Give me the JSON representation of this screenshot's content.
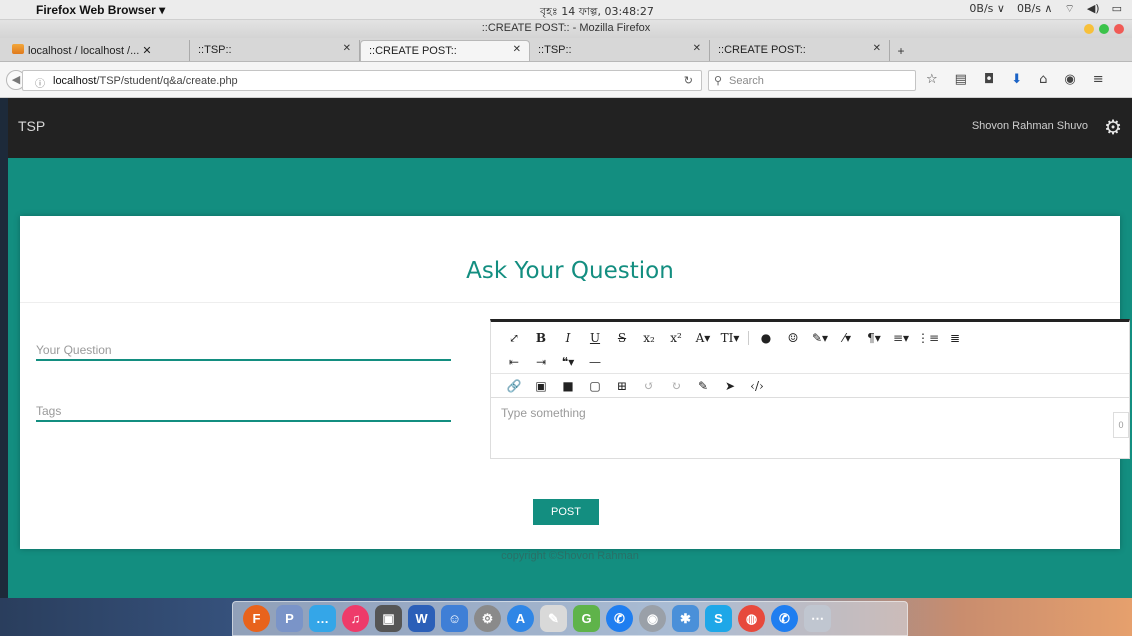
{
  "menubar": {
    "apple_icon": "",
    "app_menu": "Firefox Web Browser ▾",
    "clock": "বৃহঃ 14 ফাল্গ, 03:48:27",
    "status": [
      "0B/s ∨",
      "0B/s ∧",
      "wifi",
      "volume",
      "battery"
    ]
  },
  "window": {
    "title": "::CREATE POST:: - Mozilla Firefox",
    "lights": [
      "#f7c03a",
      "#3bc34a",
      "#f05a55"
    ]
  },
  "tabs": [
    {
      "label": "localhost / localhost /... ✕",
      "active": false
    },
    {
      "label": "::TSP::",
      "active": false
    },
    {
      "label": "::CREATE POST::",
      "active": true
    },
    {
      "label": "::TSP::",
      "active": false
    },
    {
      "label": "::CREATE POST::",
      "active": false
    }
  ],
  "new_tab": "+",
  "navbar": {
    "url_host": "localhost",
    "url_path": "/TSP/student/q&a/create.php",
    "search_placeholder": "Search"
  },
  "site": {
    "brand": "TSP",
    "user_name": "Shovon Rahman Shuvo",
    "heading": "Ask Your Question",
    "question_placeholder": "Your Question",
    "tags_placeholder": "Tags",
    "editor_placeholder": "Type something",
    "char_count": "0",
    "post_label": "POST",
    "footer": "copyright ©Shovon Rahman"
  },
  "editor_toolbar": {
    "row1": [
      "⤢",
      "B",
      "I",
      "U",
      "S",
      "x₂",
      "x²",
      "A▾",
      "TI▾",
      "●",
      "☺",
      "✎▾",
      "⁄▾",
      "¶▾",
      "≡▾",
      "⋮≡",
      "≣"
    ],
    "row2": [
      "⇤",
      "⇥",
      "❝▾",
      "—"
    ],
    "row3": [
      "🔗",
      "▣",
      "■",
      "▢",
      "⊞",
      "↺",
      "↻",
      "✎",
      "➤",
      "‹/›"
    ]
  },
  "colors": {
    "accent": "#138e80",
    "navbar_bg": "#222222"
  },
  "dock": [
    {
      "icon": "firefox-icon",
      "color": "#e8631c"
    },
    {
      "icon": "preview-icon",
      "color": "#7a94c8"
    },
    {
      "icon": "messages-icon",
      "color": "#34a6e8"
    },
    {
      "icon": "itunes-icon",
      "color": "#ee3b6a"
    },
    {
      "icon": "photo-booth-icon",
      "color": "#555555"
    },
    {
      "icon": "word-icon",
      "color": "#2b5fb8"
    },
    {
      "icon": "finder-icon",
      "color": "#3f7fd6"
    },
    {
      "icon": "sys-prefs-icon",
      "color": "#8a8a8a"
    },
    {
      "icon": "app-store-icon",
      "color": "#2f86e6"
    },
    {
      "icon": "instruments-icon",
      "color": "#d9d9d9"
    },
    {
      "icon": "growl-icon",
      "color": "#5fb34a"
    },
    {
      "icon": "messenger-icon",
      "color": "#1f7ef0"
    },
    {
      "icon": "disk-utility-icon",
      "color": "#9aa0a8"
    },
    {
      "icon": "bluetooth-icon",
      "color": "#4a90d9"
    },
    {
      "icon": "skype-icon",
      "color": "#1ea7e8"
    },
    {
      "icon": "chrome-icon",
      "color": "#e7493c"
    },
    {
      "icon": "messenger-icon-2",
      "color": "#1f7ef0"
    },
    {
      "icon": "launchpad-icon",
      "color": "#c0c6d0"
    }
  ],
  "dock_glyphs": [
    "F",
    "P",
    "…",
    "♫",
    "▣",
    "W",
    "☺",
    "⚙",
    "A",
    "✎",
    "G",
    "✆",
    "◉",
    "✱",
    "S",
    "◍",
    "✆",
    "⋯"
  ]
}
